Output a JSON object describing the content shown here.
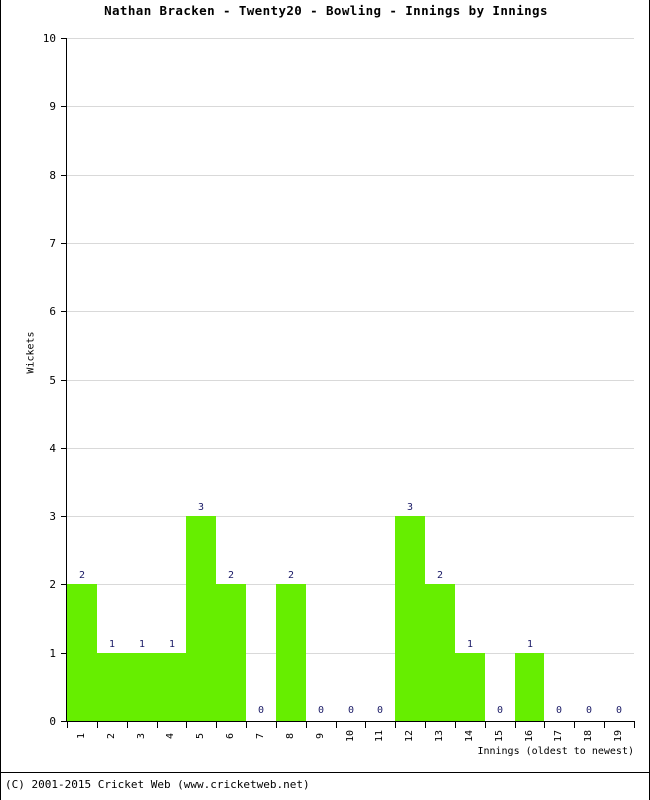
{
  "title": "Nathan Bracken - Twenty20 - Bowling - Innings by Innings",
  "axes": {
    "y_title": "Wickets",
    "x_title": "Innings (oldest to newest)",
    "y_ticks": [
      "0",
      "1",
      "2",
      "3",
      "4",
      "5",
      "6",
      "7",
      "8",
      "9",
      "10"
    ]
  },
  "footer": "(C) 2001-2015 Cricket Web (www.cricketweb.net)",
  "colors": {
    "bar": "#66ee00",
    "value_label": "#1a1a66",
    "grid": "#d9d9d9",
    "axis": "#000000"
  },
  "chart_data": {
    "type": "bar",
    "title": "Nathan Bracken - Twenty20 - Bowling - Innings by Innings",
    "xlabel": "Innings (oldest to newest)",
    "ylabel": "Wickets",
    "ylim": [
      0,
      10
    ],
    "ytick_step": 1,
    "grid": true,
    "legend": "none",
    "bar_gap": 0,
    "categories": [
      "1",
      "2",
      "3",
      "4",
      "5",
      "6",
      "7",
      "8",
      "9",
      "10",
      "11",
      "12",
      "13",
      "14",
      "15",
      "16",
      "17",
      "18",
      "19"
    ],
    "values": [
      2,
      1,
      1,
      1,
      3,
      2,
      0,
      2,
      0,
      0,
      0,
      3,
      2,
      1,
      0,
      1,
      0,
      0,
      0
    ],
    "value_labels": [
      "2",
      "1",
      "1",
      "1",
      "3",
      "2",
      "0",
      "2",
      "0",
      "0",
      "0",
      "3",
      "2",
      "1",
      "0",
      "1",
      "0",
      "0",
      "0"
    ]
  }
}
